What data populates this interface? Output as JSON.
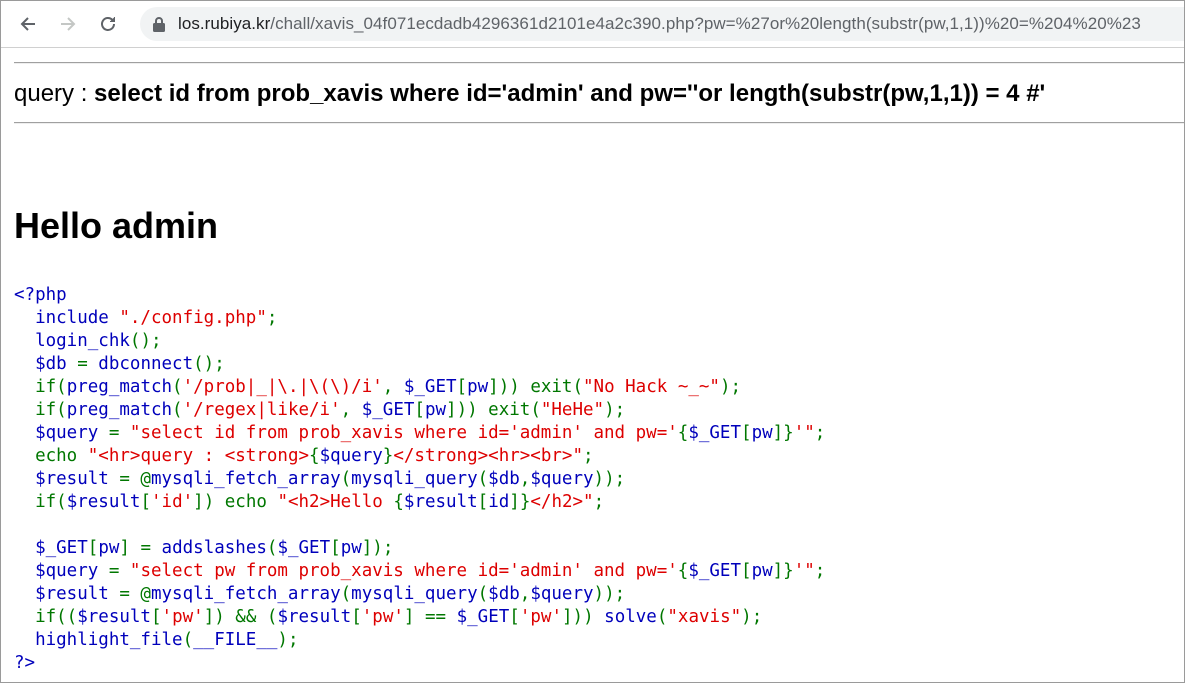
{
  "browser": {
    "url_host": "los.rubiya.kr",
    "url_path": "/chall/xavis_04f071ecdadb4296361d2101e4a2c390.php?pw=%27or%20length(substr(pw,1,1))%20=%204%20%23"
  },
  "page": {
    "query_label": "query : ",
    "query_sql": "select id from prob_xavis where id='admin' and pw=''or length(substr(pw,1,1)) = 4 #'",
    "hello_text": "Hello admin"
  },
  "source_code": [
    [
      [
        "def",
        "<?php"
      ]
    ],
    [
      [
        "def",
        "  include "
      ],
      [
        "str",
        "\"./config.php\""
      ],
      [
        "kw",
        ";"
      ]
    ],
    [
      [
        "def",
        "  login_chk"
      ],
      [
        "kw",
        "();"
      ]
    ],
    [
      [
        "def",
        "  $db "
      ],
      [
        "kw",
        "= "
      ],
      [
        "def",
        "dbconnect"
      ],
      [
        "kw",
        "();"
      ]
    ],
    [
      [
        "kw",
        "  if("
      ],
      [
        "def",
        "preg_match"
      ],
      [
        "kw",
        "("
      ],
      [
        "str",
        "'/prob|_|\\.|\\(\\)/i'"
      ],
      [
        "kw",
        ", "
      ],
      [
        "def",
        "$_GET"
      ],
      [
        "kw",
        "["
      ],
      [
        "def",
        "pw"
      ],
      [
        "kw",
        "])) exit("
      ],
      [
        "str",
        "\"No Hack ~_~\""
      ],
      [
        "kw",
        ");"
      ]
    ],
    [
      [
        "kw",
        "  if("
      ],
      [
        "def",
        "preg_match"
      ],
      [
        "kw",
        "("
      ],
      [
        "str",
        "'/regex|like/i'"
      ],
      [
        "kw",
        ", "
      ],
      [
        "def",
        "$_GET"
      ],
      [
        "kw",
        "["
      ],
      [
        "def",
        "pw"
      ],
      [
        "kw",
        "])) exit("
      ],
      [
        "str",
        "\"HeHe\""
      ],
      [
        "kw",
        ");"
      ]
    ],
    [
      [
        "def",
        "  $query "
      ],
      [
        "kw",
        "= "
      ],
      [
        "str",
        "\"select id from prob_xavis where id='admin' and pw='"
      ],
      [
        "kw",
        "{"
      ],
      [
        "def",
        "$_GET"
      ],
      [
        "kw",
        "["
      ],
      [
        "def",
        "pw"
      ],
      [
        "kw",
        "]}"
      ],
      [
        "str",
        "'\""
      ],
      [
        "kw",
        ";"
      ]
    ],
    [
      [
        "kw",
        "  echo "
      ],
      [
        "str",
        "\"<hr>query : <strong>"
      ],
      [
        "kw",
        "{"
      ],
      [
        "def",
        "$query"
      ],
      [
        "kw",
        "}"
      ],
      [
        "str",
        "</strong><hr><br>\""
      ],
      [
        "kw",
        ";"
      ]
    ],
    [
      [
        "def",
        "  $result "
      ],
      [
        "kw",
        "= @"
      ],
      [
        "def",
        "mysqli_fetch_array"
      ],
      [
        "kw",
        "("
      ],
      [
        "def",
        "mysqli_query"
      ],
      [
        "kw",
        "("
      ],
      [
        "def",
        "$db"
      ],
      [
        "kw",
        ","
      ],
      [
        "def",
        "$query"
      ],
      [
        "kw",
        "));"
      ]
    ],
    [
      [
        "kw",
        "  if("
      ],
      [
        "def",
        "$result"
      ],
      [
        "kw",
        "["
      ],
      [
        "str",
        "'id'"
      ],
      [
        "kw",
        "]) echo "
      ],
      [
        "str",
        "\"<h2>Hello "
      ],
      [
        "kw",
        "{"
      ],
      [
        "def",
        "$result"
      ],
      [
        "kw",
        "["
      ],
      [
        "def",
        "id"
      ],
      [
        "kw",
        "]}"
      ],
      [
        "str",
        "</h2>\""
      ],
      [
        "kw",
        ";"
      ]
    ],
    [
      [
        "def",
        " "
      ]
    ],
    [
      [
        "def",
        "  $_GET"
      ],
      [
        "kw",
        "["
      ],
      [
        "def",
        "pw"
      ],
      [
        "kw",
        "] = "
      ],
      [
        "def",
        "addslashes"
      ],
      [
        "kw",
        "("
      ],
      [
        "def",
        "$_GET"
      ],
      [
        "kw",
        "["
      ],
      [
        "def",
        "pw"
      ],
      [
        "kw",
        "]);"
      ]
    ],
    [
      [
        "def",
        "  $query "
      ],
      [
        "kw",
        "= "
      ],
      [
        "str",
        "\"select pw from prob_xavis where id='admin' and pw='"
      ],
      [
        "kw",
        "{"
      ],
      [
        "def",
        "$_GET"
      ],
      [
        "kw",
        "["
      ],
      [
        "def",
        "pw"
      ],
      [
        "kw",
        "]}"
      ],
      [
        "str",
        "'\""
      ],
      [
        "kw",
        ";"
      ]
    ],
    [
      [
        "def",
        "  $result "
      ],
      [
        "kw",
        "= @"
      ],
      [
        "def",
        "mysqli_fetch_array"
      ],
      [
        "kw",
        "("
      ],
      [
        "def",
        "mysqli_query"
      ],
      [
        "kw",
        "("
      ],
      [
        "def",
        "$db"
      ],
      [
        "kw",
        ","
      ],
      [
        "def",
        "$query"
      ],
      [
        "kw",
        "));"
      ]
    ],
    [
      [
        "kw",
        "  if(("
      ],
      [
        "def",
        "$result"
      ],
      [
        "kw",
        "["
      ],
      [
        "str",
        "'pw'"
      ],
      [
        "kw",
        "]) && ("
      ],
      [
        "def",
        "$result"
      ],
      [
        "kw",
        "["
      ],
      [
        "str",
        "'pw'"
      ],
      [
        "kw",
        "] == "
      ],
      [
        "def",
        "$_GET"
      ],
      [
        "kw",
        "["
      ],
      [
        "str",
        "'pw'"
      ],
      [
        "kw",
        "])) "
      ],
      [
        "def",
        "solve"
      ],
      [
        "kw",
        "("
      ],
      [
        "str",
        "\"xavis\""
      ],
      [
        "kw",
        ");"
      ]
    ],
    [
      [
        "def",
        "  highlight_file"
      ],
      [
        "kw",
        "("
      ],
      [
        "def",
        "__FILE__"
      ],
      [
        "kw",
        ");"
      ]
    ],
    [
      [
        "def",
        "?>"
      ]
    ]
  ],
  "colors": {
    "default": "#0000BB",
    "keyword": "#007700",
    "string": "#DD0000"
  }
}
